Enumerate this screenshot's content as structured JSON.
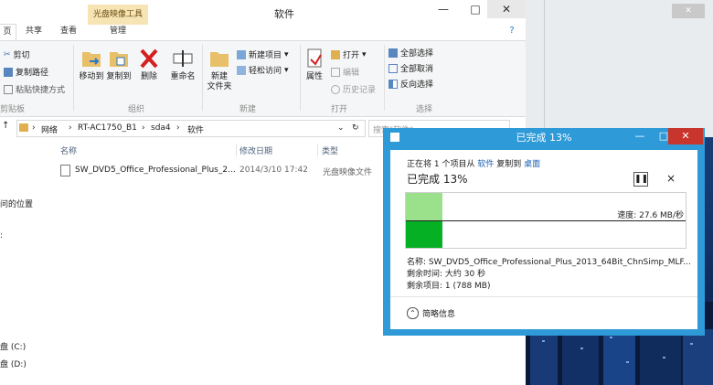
{
  "explorer": {
    "title": "软件",
    "context_tab_group": "光盘映像工具",
    "tabs": [
      "页",
      "共享",
      "查看",
      "管理"
    ],
    "ribbon": {
      "clipboard": {
        "cut": "剪切",
        "copy_path": "复制路径",
        "paste_shortcut": "粘贴快捷方式",
        "group": "剪贴板"
      },
      "organize": {
        "move_to": "移动到",
        "copy_to": "复制到",
        "delete": "删除",
        "rename": "重命名",
        "group": "组织"
      },
      "new": {
        "new_folder": "新建\n文件夹",
        "new_item": "新建项目",
        "easy_access": "轻松访问",
        "group": "新建"
      },
      "open": {
        "properties": "属性",
        "open": "打开",
        "edit": "编辑",
        "history": "历史记录",
        "group": "打开"
      },
      "select": {
        "select_all": "全部选择",
        "select_none": "全部取消",
        "invert": "反向选择",
        "group": "选择"
      }
    },
    "address": {
      "crumbs": [
        "网络",
        "RT-AC1750_B1",
        "sda4",
        "软件"
      ],
      "search_placeholder": "搜索\"软件\""
    },
    "columns": {
      "name": "名称",
      "date": "修改日期",
      "type": "类型"
    },
    "files": [
      {
        "name": "SW_DVD5_Office_Professional_Plus_2...",
        "date": "2014/3/10 17:42",
        "type": "光盘映像文件"
      }
    ],
    "nav": {
      "recent": "问的位置",
      "drive_c": "盘 (C:)",
      "drive_d": "盘 (D:)"
    }
  },
  "dialog": {
    "title": "已完成 13%",
    "from_prefix": "正在将 1 个项目从",
    "from_link": "软件",
    "to_text": "复制到",
    "to_link": "桌面",
    "progress_label": "已完成 13%",
    "progress_percent": 13,
    "speed": "速度: 27.6 MB/秒",
    "name_label": "名称:",
    "name_value": "SW_DVD5_Office_Professional_Plus_2013_64Bit_ChnSimp_MLF...",
    "time_left": "剩余时间:  大约 30 秒",
    "items_left": "剩余项目: 1 (788 MB)",
    "less_details": "简略信息",
    "colors": {
      "frame": "#2e9ad8",
      "graph_fill": "#06b025",
      "graph_done": "#9be08a"
    }
  }
}
